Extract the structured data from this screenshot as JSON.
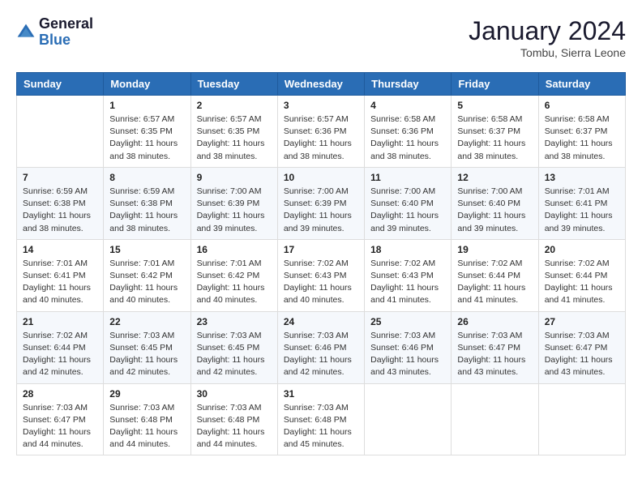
{
  "logo": {
    "general": "General",
    "blue": "Blue"
  },
  "title": "January 2024",
  "location": "Tombu, Sierra Leone",
  "days_of_week": [
    "Sunday",
    "Monday",
    "Tuesday",
    "Wednesday",
    "Thursday",
    "Friday",
    "Saturday"
  ],
  "weeks": [
    [
      {
        "day": "",
        "sunrise": "",
        "sunset": "",
        "daylight": ""
      },
      {
        "day": "1",
        "sunrise": "Sunrise: 6:57 AM",
        "sunset": "Sunset: 6:35 PM",
        "daylight": "Daylight: 11 hours and 38 minutes."
      },
      {
        "day": "2",
        "sunrise": "Sunrise: 6:57 AM",
        "sunset": "Sunset: 6:35 PM",
        "daylight": "Daylight: 11 hours and 38 minutes."
      },
      {
        "day": "3",
        "sunrise": "Sunrise: 6:57 AM",
        "sunset": "Sunset: 6:36 PM",
        "daylight": "Daylight: 11 hours and 38 minutes."
      },
      {
        "day": "4",
        "sunrise": "Sunrise: 6:58 AM",
        "sunset": "Sunset: 6:36 PM",
        "daylight": "Daylight: 11 hours and 38 minutes."
      },
      {
        "day": "5",
        "sunrise": "Sunrise: 6:58 AM",
        "sunset": "Sunset: 6:37 PM",
        "daylight": "Daylight: 11 hours and 38 minutes."
      },
      {
        "day": "6",
        "sunrise": "Sunrise: 6:58 AM",
        "sunset": "Sunset: 6:37 PM",
        "daylight": "Daylight: 11 hours and 38 minutes."
      }
    ],
    [
      {
        "day": "7",
        "sunrise": "Sunrise: 6:59 AM",
        "sunset": "Sunset: 6:38 PM",
        "daylight": "Daylight: 11 hours and 38 minutes."
      },
      {
        "day": "8",
        "sunrise": "Sunrise: 6:59 AM",
        "sunset": "Sunset: 6:38 PM",
        "daylight": "Daylight: 11 hours and 38 minutes."
      },
      {
        "day": "9",
        "sunrise": "Sunrise: 7:00 AM",
        "sunset": "Sunset: 6:39 PM",
        "daylight": "Daylight: 11 hours and 39 minutes."
      },
      {
        "day": "10",
        "sunrise": "Sunrise: 7:00 AM",
        "sunset": "Sunset: 6:39 PM",
        "daylight": "Daylight: 11 hours and 39 minutes."
      },
      {
        "day": "11",
        "sunrise": "Sunrise: 7:00 AM",
        "sunset": "Sunset: 6:40 PM",
        "daylight": "Daylight: 11 hours and 39 minutes."
      },
      {
        "day": "12",
        "sunrise": "Sunrise: 7:00 AM",
        "sunset": "Sunset: 6:40 PM",
        "daylight": "Daylight: 11 hours and 39 minutes."
      },
      {
        "day": "13",
        "sunrise": "Sunrise: 7:01 AM",
        "sunset": "Sunset: 6:41 PM",
        "daylight": "Daylight: 11 hours and 39 minutes."
      }
    ],
    [
      {
        "day": "14",
        "sunrise": "Sunrise: 7:01 AM",
        "sunset": "Sunset: 6:41 PM",
        "daylight": "Daylight: 11 hours and 40 minutes."
      },
      {
        "day": "15",
        "sunrise": "Sunrise: 7:01 AM",
        "sunset": "Sunset: 6:42 PM",
        "daylight": "Daylight: 11 hours and 40 minutes."
      },
      {
        "day": "16",
        "sunrise": "Sunrise: 7:01 AM",
        "sunset": "Sunset: 6:42 PM",
        "daylight": "Daylight: 11 hours and 40 minutes."
      },
      {
        "day": "17",
        "sunrise": "Sunrise: 7:02 AM",
        "sunset": "Sunset: 6:43 PM",
        "daylight": "Daylight: 11 hours and 40 minutes."
      },
      {
        "day": "18",
        "sunrise": "Sunrise: 7:02 AM",
        "sunset": "Sunset: 6:43 PM",
        "daylight": "Daylight: 11 hours and 41 minutes."
      },
      {
        "day": "19",
        "sunrise": "Sunrise: 7:02 AM",
        "sunset": "Sunset: 6:44 PM",
        "daylight": "Daylight: 11 hours and 41 minutes."
      },
      {
        "day": "20",
        "sunrise": "Sunrise: 7:02 AM",
        "sunset": "Sunset: 6:44 PM",
        "daylight": "Daylight: 11 hours and 41 minutes."
      }
    ],
    [
      {
        "day": "21",
        "sunrise": "Sunrise: 7:02 AM",
        "sunset": "Sunset: 6:44 PM",
        "daylight": "Daylight: 11 hours and 42 minutes."
      },
      {
        "day": "22",
        "sunrise": "Sunrise: 7:03 AM",
        "sunset": "Sunset: 6:45 PM",
        "daylight": "Daylight: 11 hours and 42 minutes."
      },
      {
        "day": "23",
        "sunrise": "Sunrise: 7:03 AM",
        "sunset": "Sunset: 6:45 PM",
        "daylight": "Daylight: 11 hours and 42 minutes."
      },
      {
        "day": "24",
        "sunrise": "Sunrise: 7:03 AM",
        "sunset": "Sunset: 6:46 PM",
        "daylight": "Daylight: 11 hours and 42 minutes."
      },
      {
        "day": "25",
        "sunrise": "Sunrise: 7:03 AM",
        "sunset": "Sunset: 6:46 PM",
        "daylight": "Daylight: 11 hours and 43 minutes."
      },
      {
        "day": "26",
        "sunrise": "Sunrise: 7:03 AM",
        "sunset": "Sunset: 6:47 PM",
        "daylight": "Daylight: 11 hours and 43 minutes."
      },
      {
        "day": "27",
        "sunrise": "Sunrise: 7:03 AM",
        "sunset": "Sunset: 6:47 PM",
        "daylight": "Daylight: 11 hours and 43 minutes."
      }
    ],
    [
      {
        "day": "28",
        "sunrise": "Sunrise: 7:03 AM",
        "sunset": "Sunset: 6:47 PM",
        "daylight": "Daylight: 11 hours and 44 minutes."
      },
      {
        "day": "29",
        "sunrise": "Sunrise: 7:03 AM",
        "sunset": "Sunset: 6:48 PM",
        "daylight": "Daylight: 11 hours and 44 minutes."
      },
      {
        "day": "30",
        "sunrise": "Sunrise: 7:03 AM",
        "sunset": "Sunset: 6:48 PM",
        "daylight": "Daylight: 11 hours and 44 minutes."
      },
      {
        "day": "31",
        "sunrise": "Sunrise: 7:03 AM",
        "sunset": "Sunset: 6:48 PM",
        "daylight": "Daylight: 11 hours and 45 minutes."
      },
      {
        "day": "",
        "sunrise": "",
        "sunset": "",
        "daylight": ""
      },
      {
        "day": "",
        "sunrise": "",
        "sunset": "",
        "daylight": ""
      },
      {
        "day": "",
        "sunrise": "",
        "sunset": "",
        "daylight": ""
      }
    ]
  ]
}
